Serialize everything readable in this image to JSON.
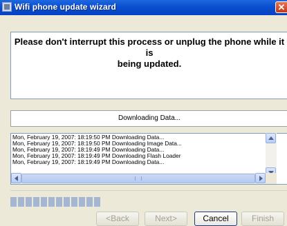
{
  "window": {
    "title": "Wifi phone update wizard",
    "close_glyph": "✕"
  },
  "message": {
    "line1": "Please don't interrupt this process or unplug the phone while it is",
    "line2": "being updated."
  },
  "status": {
    "text": "Downloading Data..."
  },
  "log": {
    "lines": [
      "Mon, February 19, 2007:  18:19:50 PM  Downloading Data...",
      "Mon, February 19, 2007:  18:19:50 PM  Downloading Image Data...",
      "Mon, February 19, 2007:  18:19:49 PM  Downloading Data...",
      "Mon, February 19, 2007:  18:19:49 PM  Downloading Flash Loader",
      "Mon, February 19, 2007:  18:19:49 PM  Downloading Data..."
    ]
  },
  "progress": {
    "segments_filled": 12,
    "color": "#a4b6d2"
  },
  "buttons": {
    "back": "<Back",
    "next": "Next>",
    "cancel": "Cancel",
    "finish": "Finish"
  },
  "colors": {
    "accent_titlebar": "#0a4ed0",
    "background": "#f07a18"
  },
  "icons": {
    "title": "app-window-icon",
    "close": "close-icon",
    "scroll_up": "arrow-up-icon",
    "scroll_down": "arrow-down-icon",
    "scroll_left": "arrow-left-icon",
    "scroll_right": "arrow-right-icon"
  }
}
